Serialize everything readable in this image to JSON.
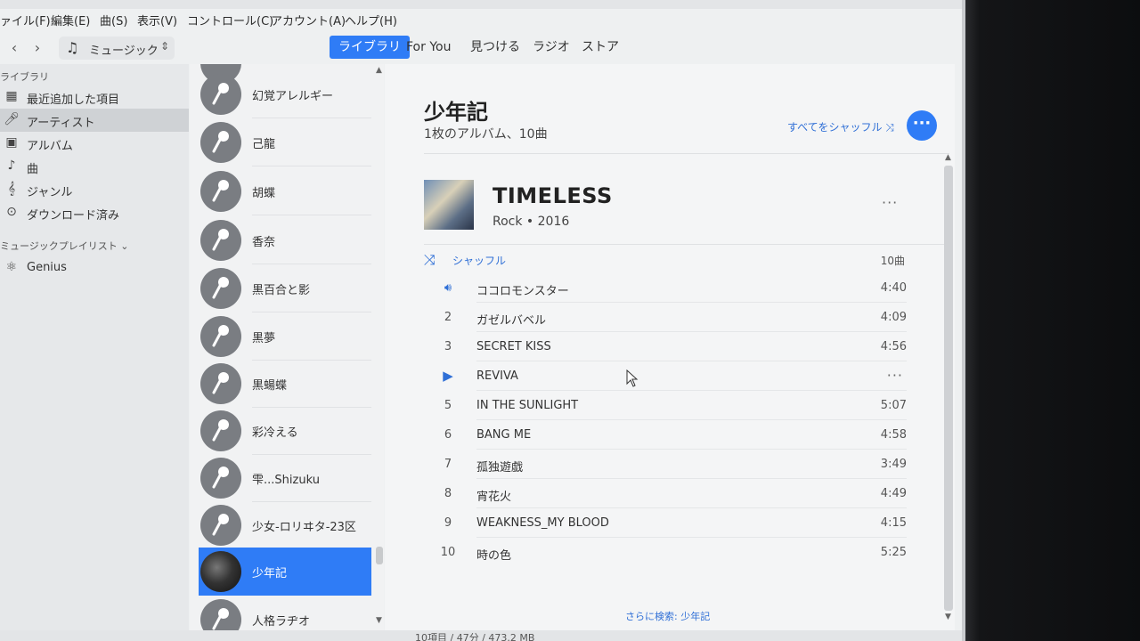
{
  "menu": [
    "ァイル(F)",
    "編集(E)",
    "曲(S)",
    "表示(V)",
    "コントロール(C)",
    "アカウント(A)",
    "ヘルプ(H)"
  ],
  "toolbar": {
    "media_label": "ミュージック",
    "tabs": [
      "ライブラリ",
      "For You",
      "見つける",
      "ラジオ",
      "ストア"
    ],
    "active_tab": "ライブラリ"
  },
  "sidebar": {
    "library_header": "ライブラリ",
    "items": [
      {
        "label": "最近追加した項目",
        "icon": "calendar-icon"
      },
      {
        "label": "アーティスト",
        "icon": "microphone-icon"
      },
      {
        "label": "アルバム",
        "icon": "album-icon"
      },
      {
        "label": "曲",
        "icon": "note-icon"
      },
      {
        "label": "ジャンル",
        "icon": "genre-icon"
      },
      {
        "label": "ダウンロード済み",
        "icon": "download-icon"
      }
    ],
    "selected": "アーティスト",
    "playlists_header": "ミュージックプレイリスト",
    "playlists": [
      {
        "label": "Genius",
        "icon": "atom-icon"
      }
    ]
  },
  "artists": [
    "幻覚アレルギー",
    "己龍",
    "胡蝶",
    "香奈",
    "黒百合と影",
    "黒夢",
    "黒蝪蝶",
    "彩冷える",
    "雫...Shizuku",
    "少女-ロリヰタ-23区",
    "少年記",
    "人格ラヂオ"
  ],
  "selected_artist": "少年記",
  "main": {
    "artist_name": "少年記",
    "summary": "1枚のアルバム、10曲",
    "shuffle_all": "すべてをシャッフル",
    "album": {
      "title": "TIMELESS",
      "meta": "Rock • 2016"
    },
    "shuffle_label": "シャッフル",
    "track_count": "10曲",
    "tracks": [
      {
        "num": "",
        "title": "ココロモンスター",
        "duration": "4:40",
        "state": "playing"
      },
      {
        "num": "2",
        "title": "ガゼルバベル",
        "duration": "4:09"
      },
      {
        "num": "3",
        "title": "SECRET KISS",
        "duration": "4:56"
      },
      {
        "num": "",
        "title": "REVIVA",
        "duration": "",
        "state": "hover"
      },
      {
        "num": "5",
        "title": "IN THE SUNLIGHT",
        "duration": "5:07"
      },
      {
        "num": "6",
        "title": "BANG ME",
        "duration": "4:58"
      },
      {
        "num": "7",
        "title": "孤独遊戯",
        "duration": "3:49"
      },
      {
        "num": "8",
        "title": "宵花火",
        "duration": "4:49"
      },
      {
        "num": "9",
        "title": "WEAKNESS_MY BLOOD",
        "duration": "4:15"
      },
      {
        "num": "10",
        "title": "時の色",
        "duration": "5:25"
      }
    ],
    "more_search": "さらに検索: 少年記"
  },
  "status_bar": "10項目 / 47分 / 473.2 MB",
  "colors": {
    "accent": "#2f7cf6",
    "link": "#2f6fd6"
  }
}
